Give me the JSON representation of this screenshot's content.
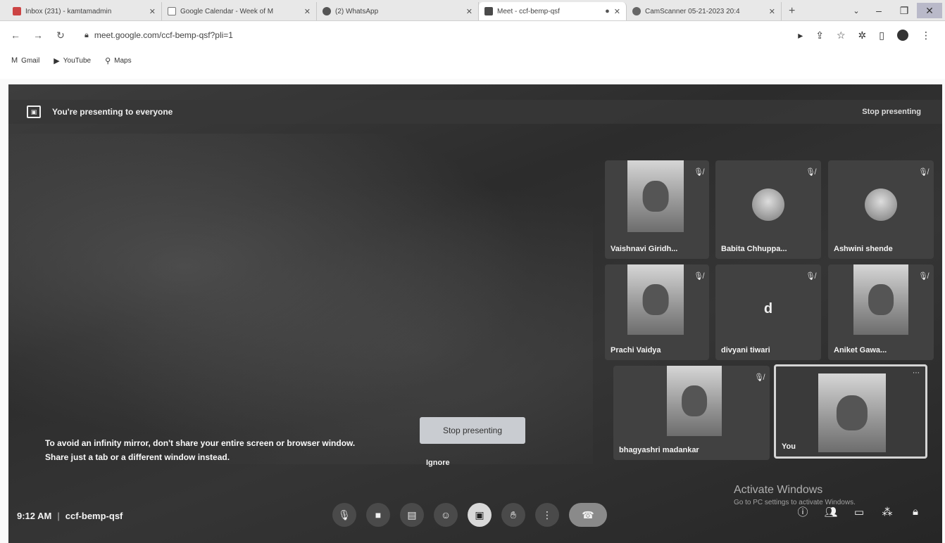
{
  "tabs": [
    {
      "title": "Inbox (231) - kamtamadmin",
      "active": false
    },
    {
      "title": "Google Calendar - Week of M",
      "active": false
    },
    {
      "title": "(2) WhatsApp",
      "active": false
    },
    {
      "title": "Meet - ccf-bemp-qsf",
      "active": true
    },
    {
      "title": "CamScanner 05-21-2023 20:4",
      "active": false
    }
  ],
  "url": "meet.google.com/ccf-bemp-qsf?pli=1",
  "bookmarks": [
    {
      "icon": "gmail-icon",
      "label": "Gmail"
    },
    {
      "icon": "youtube-icon",
      "label": "YouTube"
    },
    {
      "icon": "maps-icon",
      "label": "Maps"
    }
  ],
  "banner": {
    "text": "You're presenting to everyone",
    "stop": "Stop presenting"
  },
  "warning": {
    "line1": "To avoid an infinity mirror, don't share your entire screen or browser window.",
    "line2": "Share just a tab or a different window instead.",
    "button": "Stop presenting",
    "ignore": "Ignore"
  },
  "participants": [
    {
      "name": "Vaishnavi Giridh...",
      "type": "video"
    },
    {
      "name": "Babita Chhuppa...",
      "type": "avatar"
    },
    {
      "name": "Ashwini shende",
      "type": "avatar"
    },
    {
      "name": "Prachi Vaidya",
      "type": "video"
    },
    {
      "name": "divyani tiwari",
      "type": "letter",
      "letter": "d"
    },
    {
      "name": "Aniket Gawa...",
      "type": "video"
    },
    {
      "name": "bhagyashri madankar",
      "type": "video"
    },
    {
      "name": "You",
      "type": "video"
    }
  ],
  "meeting": {
    "time": "9:12 AM",
    "separator": "|",
    "code": "ccf-bemp-qsf"
  },
  "activation": {
    "title": "Activate Windows",
    "sub": "Go to PC settings to activate Windows."
  }
}
